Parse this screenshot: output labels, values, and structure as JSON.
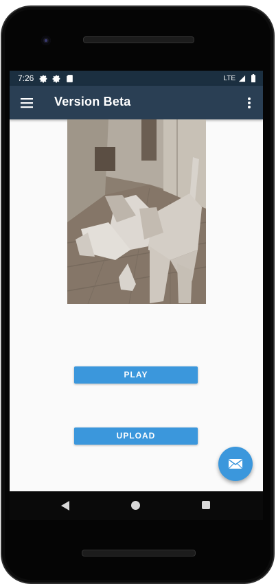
{
  "status_bar": {
    "time": "7:26",
    "network": "LTE",
    "left_icons": [
      "settings-icon",
      "settings-icon",
      "sd-card-icon"
    ],
    "right_icons": [
      "signal-icon",
      "battery-icon"
    ]
  },
  "app_bar": {
    "title": "Version Beta",
    "nav_icon": "menu-icon",
    "action_icon": "more-vert-icon",
    "background": "#2a3f54"
  },
  "main": {
    "preview_image": "dog-room-frame",
    "buttons": {
      "play_label": "PLAY",
      "upload_label": "UPLOAD"
    },
    "fab_icon": "mail-icon",
    "accent": "#3b97dc"
  },
  "nav_bar": {
    "items": [
      "back-icon",
      "home-icon",
      "recents-icon"
    ]
  }
}
